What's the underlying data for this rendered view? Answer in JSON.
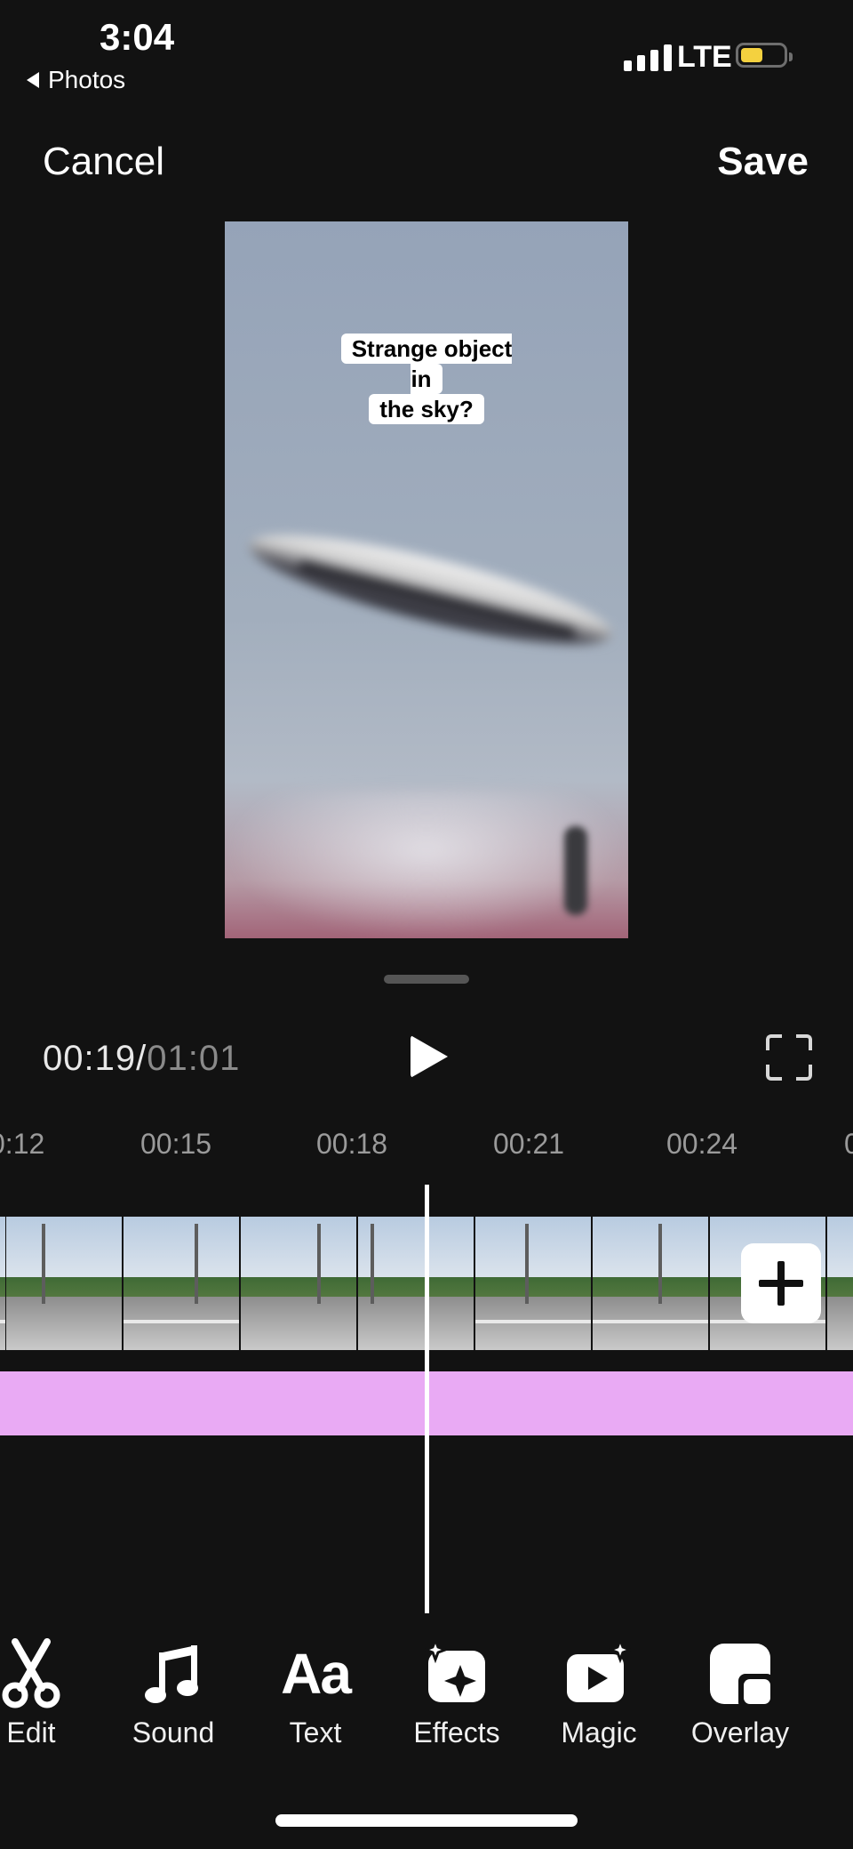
{
  "status_bar": {
    "time": "3:04",
    "back_app": "Photos",
    "network": "LTE"
  },
  "header": {
    "cancel": "Cancel",
    "save": "Save"
  },
  "video": {
    "caption_line1": "Strange object in",
    "caption_line2": "the sky?"
  },
  "playback": {
    "current": "00:19",
    "separator": "/",
    "duration": "01:01"
  },
  "ruler": [
    "0:12",
    "00:15",
    "00:18",
    "00:21",
    "00:24",
    "0"
  ],
  "toolbar": {
    "edit": "Edit",
    "sound": "Sound",
    "text": "Text",
    "effects": "Effects",
    "magic": "Magic",
    "overlay": "Overlay"
  },
  "colors": {
    "background": "#121212",
    "audio_track": "#e9aaf4",
    "battery": "#f4d13f"
  },
  "icons": [
    "chevron-left-icon",
    "signal-icon",
    "battery-icon",
    "play-icon",
    "fullscreen-icon",
    "plus-icon",
    "scissors-icon",
    "music-note-icon",
    "text-aa-icon",
    "sparkle-effects-icon",
    "magic-video-icon",
    "overlay-icon"
  ]
}
